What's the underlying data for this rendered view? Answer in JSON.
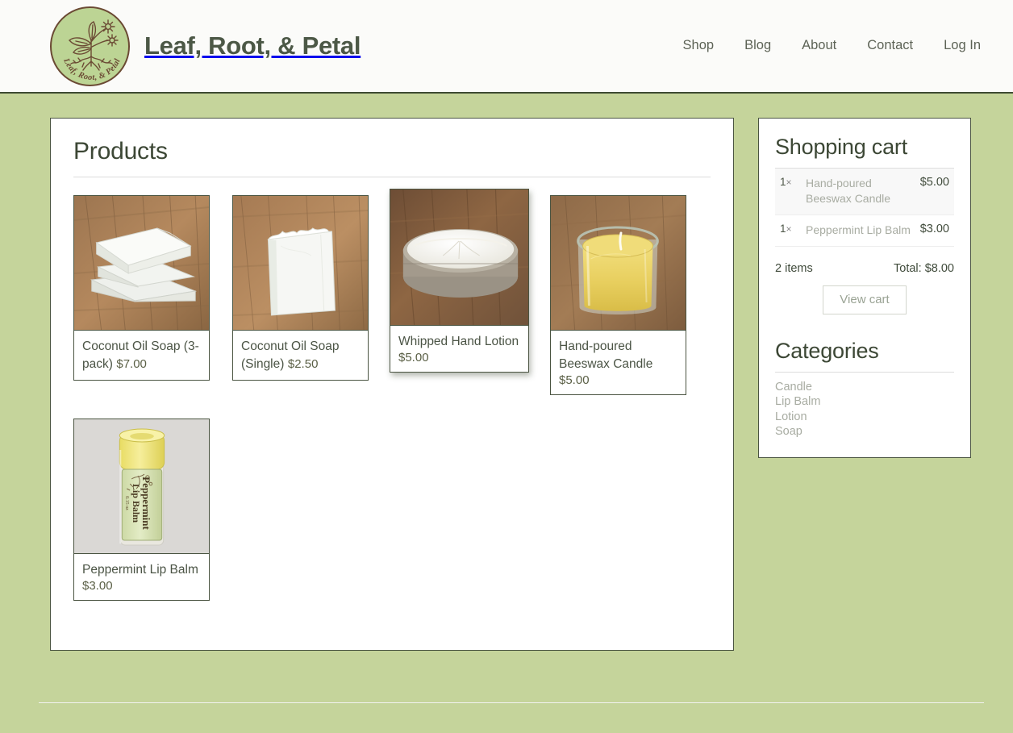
{
  "header": {
    "logo_icon": "leaf-root-petal-logo-icon",
    "logo_text": "Leaf, Root, & Petal",
    "site_title": "Leaf, Root, & Petal",
    "nav": [
      {
        "label": "Shop"
      },
      {
        "label": "Blog"
      },
      {
        "label": "About"
      },
      {
        "label": "Contact"
      },
      {
        "label": "Log In"
      }
    ]
  },
  "main": {
    "title": "Products",
    "products": [
      {
        "name": "Coconut Oil Soap (3-pack)",
        "price": "$7.00",
        "image_alt": "stack-of-white-coconut-oil-soap-bars-on-wood"
      },
      {
        "name": "Coconut Oil Soap (Single)",
        "price": "$2.50",
        "image_alt": "single-white-coconut-oil-soap-bar-on-wood"
      },
      {
        "name": "Whipped Hand Lotion",
        "price": "$5.00",
        "image_alt": "open-metal-tin-of-white-whipped-hand-lotion-on-wood",
        "hovered": true
      },
      {
        "name": "Hand-poured Beeswax Candle",
        "price": "$5.00",
        "image_alt": "yellow-beeswax-candle-in-glass-jar-on-wood"
      },
      {
        "name": "Peppermint Lip Balm",
        "price": "$3.00",
        "image_alt": "yellow-capped-peppermint-lip-balm-tube-with-green-label"
      }
    ]
  },
  "sidebar": {
    "cart": {
      "title": "Shopping cart",
      "items": [
        {
          "qty": "1",
          "times": "×",
          "name": "Hand-poured Beeswax Candle",
          "price": "$5.00"
        },
        {
          "qty": "1",
          "times": "×",
          "name": "Peppermint Lip Balm",
          "price": "$3.00"
        }
      ],
      "item_count": "2 items",
      "total": "Total: $8.00",
      "view_cart_label": "View cart"
    },
    "categories": {
      "title": "Categories",
      "items": [
        {
          "label": "Candle"
        },
        {
          "label": "Lip Balm"
        },
        {
          "label": "Lotion"
        },
        {
          "label": "Soap"
        }
      ]
    }
  },
  "colors": {
    "page_background": "#c5d49b",
    "header_background": "#fbfbf9",
    "header_border": "#3d4a32",
    "panel_background": "#ffffff",
    "panel_border": "#4a5441",
    "heading_text": "#3c4735",
    "muted_link": "#a8aca2",
    "price_text": "#5a5f45"
  }
}
